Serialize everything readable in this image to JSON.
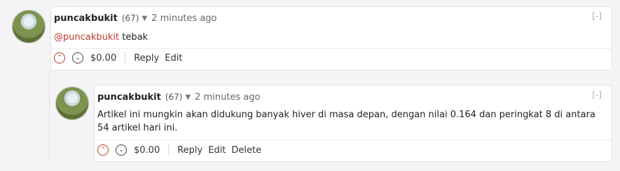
{
  "comments": [
    {
      "username": "puncakbukit",
      "reputation": "(67)",
      "time": "2 minutes ago",
      "collapse": "[-]",
      "mention": "@puncakbukit",
      "text": " tebak",
      "payout": "$0.00",
      "actions": [
        "Reply",
        "Edit"
      ]
    },
    {
      "username": "puncakbukit",
      "reputation": "(67)",
      "time": "2 minutes ago",
      "collapse": "[-]",
      "text": "Artikel ini mungkin akan didukung banyak hiver di masa depan, dengan nilai 0.164 dan peringkat 8 di antara 54 artikel hari ini.",
      "payout": "$0.00",
      "actions": [
        "Reply",
        "Edit",
        "Delete"
      ]
    }
  ],
  "icons": {
    "upvote": "chevron-up-icon",
    "downvote": "chevron-down-icon",
    "dropdown": "caret-down-icon"
  },
  "colors": {
    "mention": "#c0392b",
    "upvote": "#c0392b"
  }
}
